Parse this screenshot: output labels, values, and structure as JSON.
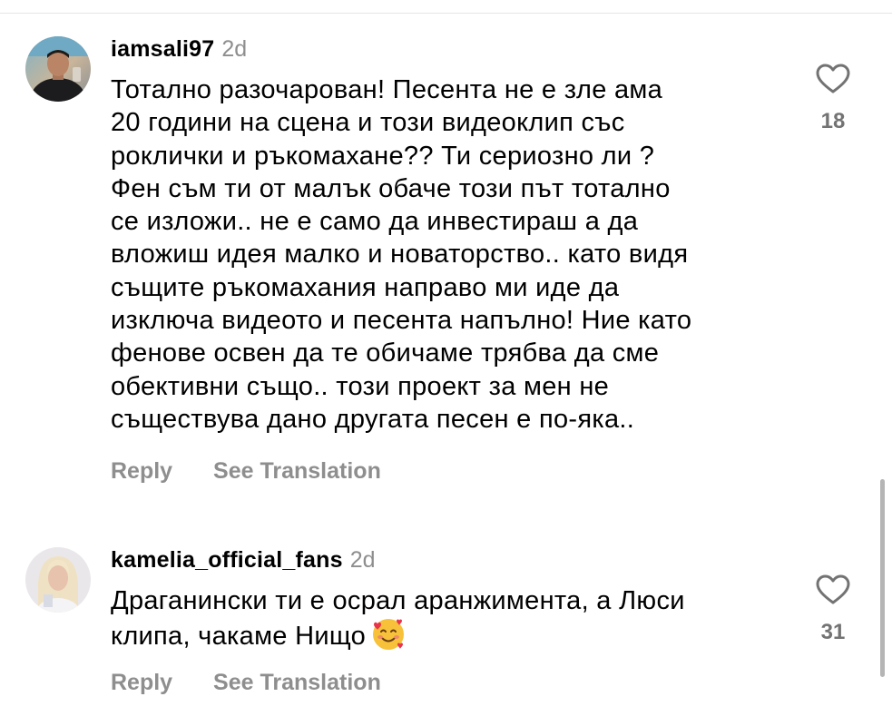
{
  "comments": [
    {
      "username": "iamsali97",
      "time": "2d",
      "lines": [
        "Тотално разочарован! Песента не е зле ама",
        "20 години на сцена и този видеоклип със",
        "рокли­чки и ръкомахане?? Ти сериозно ли ?",
        "Фен съм ти от малък обаче този път тотално",
        "се изложи.. не е само да инвестираш а да",
        "вложиш идея малко и новаторство.. като видя",
        "същите ръкомахания направо ми иде да",
        "изключа видеото и песента напълно! Ние като",
        "фенове освен да те обичаме трябва да сме",
        "обективни също.. този проект за мен не",
        "съществува дано другата песен е по-яка.."
      ],
      "likes": "18",
      "reply_label": "Reply",
      "translate_label": "See Translation",
      "avatar_icon": "avatar-photo-man"
    },
    {
      "username": "kamelia_official_fans",
      "time": "2d",
      "lines": [
        "Драганински ти е осрал аранжимента, а Люси",
        "клипа, чакаме Нищо"
      ],
      "emoji": "🥰",
      "likes": "31",
      "reply_label": "Reply",
      "translate_label": "See Translation",
      "avatar_icon": "avatar-photo-woman"
    }
  ],
  "icons": {
    "like": "heart-outline-icon",
    "emoji": "smiling-face-with-hearts-icon"
  },
  "colors": {
    "text": "#000000",
    "secondary": "#8e8e8e",
    "like_count": "#737373",
    "divider": "#e6e6e6"
  }
}
